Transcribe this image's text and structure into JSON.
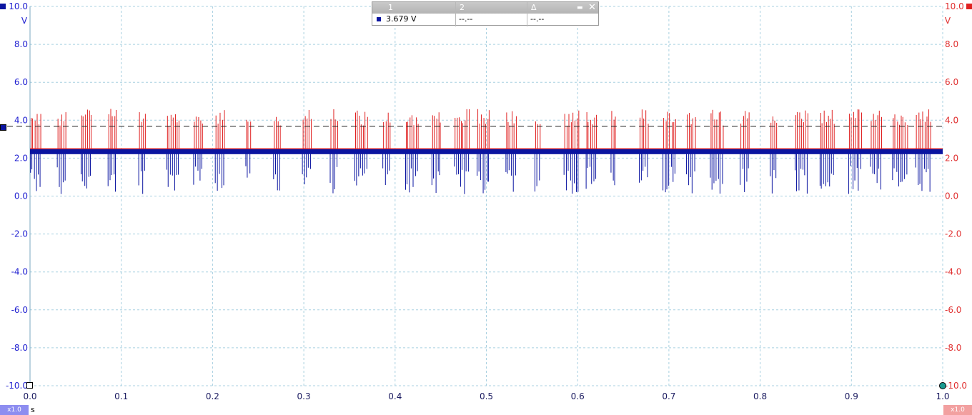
{
  "chart_data": {
    "type": "line",
    "x_axis": {
      "range": [
        0.0,
        1.0
      ],
      "ticks": [
        "0.0",
        "0.1",
        "0.2",
        "0.3",
        "0.4",
        "0.5",
        "0.6",
        "0.7",
        "0.8",
        "0.9",
        "1.0"
      ],
      "unit": "s"
    },
    "y_axis_left": {
      "range": [
        -10.0,
        10.0
      ],
      "ticks": [
        "10.0",
        "8.0",
        "6.0",
        "4.0",
        "2.0",
        "0.0",
        "-2.0",
        "-4.0",
        "-6.0",
        "-8.0",
        "-10.0"
      ],
      "unit": "V",
      "color": "#1f1fd0"
    },
    "y_axis_right": {
      "range": [
        -10.0,
        10.0
      ],
      "ticks": [
        "10.0",
        "8.0",
        "6.0",
        "4.0",
        "2.0",
        "0.0",
        "-2.0",
        "-4.0",
        "-6.0",
        "-8.0",
        "-10.0"
      ],
      "unit": "V",
      "color": "#e03030"
    },
    "grid": true,
    "series": [
      {
        "color": "#e02020",
        "baseline": 2.4,
        "spikes": "upward",
        "spike_peak_range": [
          3.7,
          4.6
        ]
      },
      {
        "color": "#0a14a0",
        "baseline": 2.35,
        "spikes": "downward",
        "spike_trough_range": [
          0.1,
          1.6
        ]
      }
    ],
    "ruler_level": 3.679
  },
  "ruler_panel": {
    "col1": "1",
    "col2": "2",
    "col3": "Δ",
    "val1": "3.679 V",
    "val2": "--.--",
    "val3": "--.--",
    "minimize_glyph": "▬",
    "close_glyph": "✕"
  },
  "badges": {
    "left": "x1.0",
    "right": "x1.0"
  },
  "colors": {
    "channel_a": "#0a14a0",
    "channel_b": "#e02020",
    "grid": "#a8d0e0",
    "ruler": "#202020"
  }
}
